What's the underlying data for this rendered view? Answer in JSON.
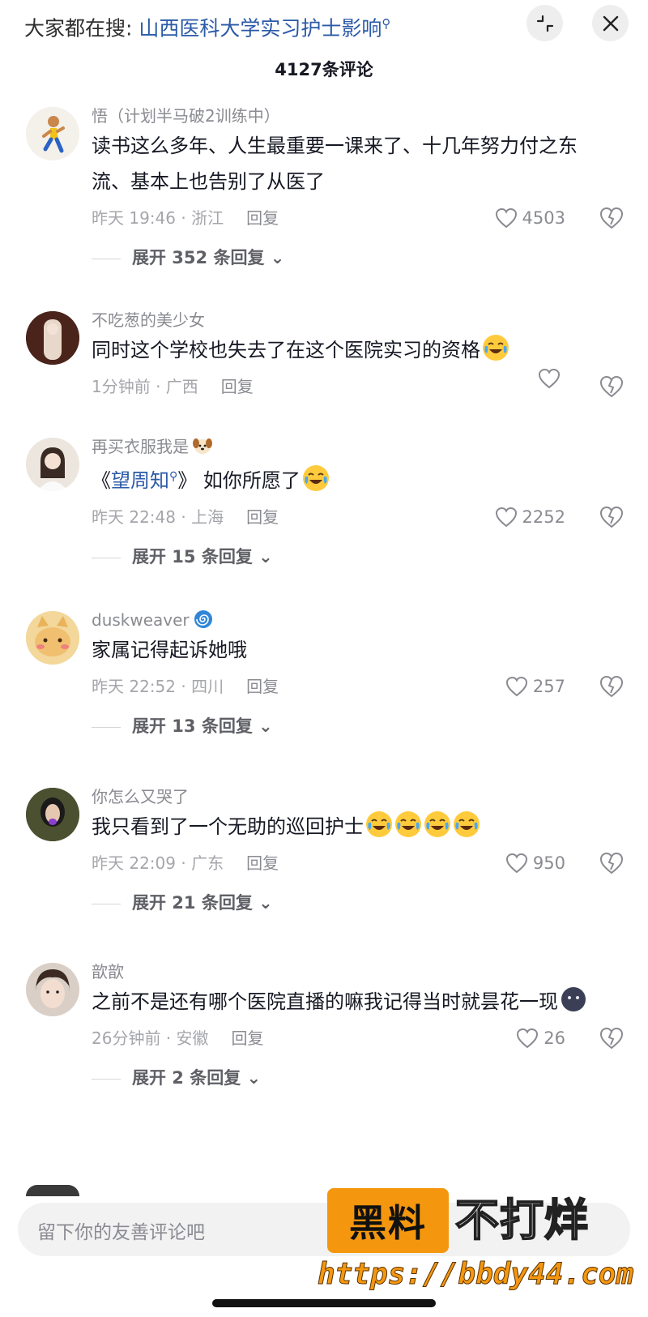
{
  "header": {
    "search_prefix": "大家都在搜:",
    "search_term": "山西医科大学实习护士影响",
    "collapse_icon": "collapse-icon",
    "close_icon": "close-icon"
  },
  "comment_count": "4127条评论",
  "comments": [
    {
      "username": "悟（计划半马破2训练中）",
      "text": "读书这么多年、人生最重要一课来了、十几年努力付之东流、基本上也告别了从医了",
      "time_location": "昨天 19:46 · 浙江",
      "reply_label": "回复",
      "likes": "4503",
      "expand": "展开 352 条回复"
    },
    {
      "username": "不吃葱的美少女",
      "text": "同时这个学校也失去了在这个医院实习的资格",
      "text_emoji": "crying-laughing-emoji",
      "time_location": "1分钟前 · 广西",
      "reply_label": "回复",
      "likes": ""
    },
    {
      "username": "再买衣服我是",
      "username_emoji": "dog-emoji",
      "text_prefix": "《",
      "text_link": "望周知",
      "text_suffix": "》 如你所愿了",
      "text_emoji": "crying-laughing-emoji",
      "time_location": "昨天 22:48 · 上海",
      "reply_label": "回复",
      "likes": "2252",
      "expand": "展开 15 条回复"
    },
    {
      "username": "duskweaver",
      "username_emoji": "spiral-emoji",
      "text": "家属记得起诉她哦",
      "time_location": "昨天 22:52 · 四川",
      "reply_label": "回复",
      "likes": "257",
      "expand": "展开 13 条回复"
    },
    {
      "username": "你怎么又哭了",
      "text": "我只看到了一个无助的巡回护士",
      "text_emoji_count": 4,
      "time_location": "昨天 22:09 · 广东",
      "reply_label": "回复",
      "likes": "950",
      "expand": "展开 21 条回复"
    },
    {
      "username": "歆歆",
      "text": "之前不是还有哪个医院直播的嘛我记得当时就昙花一现",
      "text_emoji": "blob-emoji",
      "time_location": "26分钟前 · 安徽",
      "reply_label": "回复",
      "likes": "26",
      "expand": "展开 2 条回复"
    }
  ],
  "input": {
    "placeholder": "留下你的友善评论吧"
  },
  "watermark": {
    "box_text": "黑料",
    "side_text": "不打烊",
    "url": "https://bbdy44.com"
  },
  "colors": {
    "link": "#2b5aa7",
    "watermark_orange": "#f4970f",
    "meta_gray": "#a5a6ab"
  }
}
